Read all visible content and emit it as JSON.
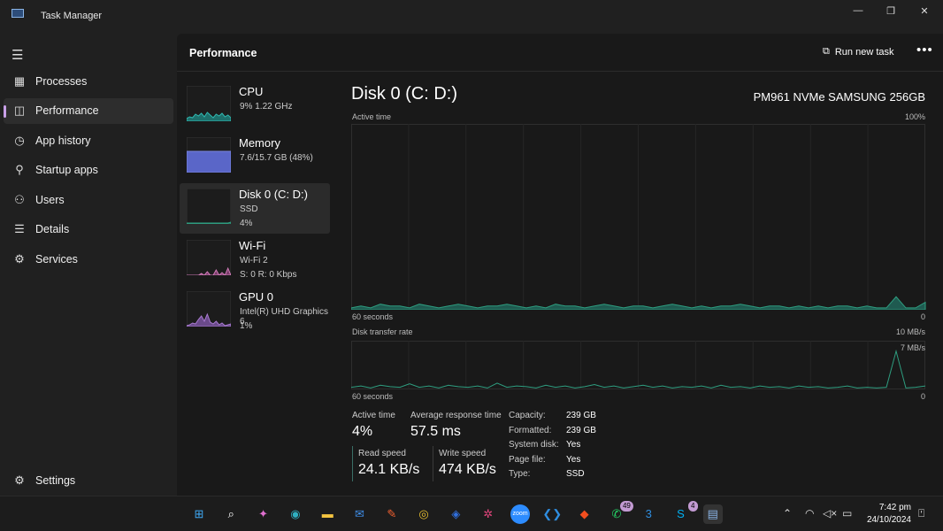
{
  "window": {
    "title": "Task Manager",
    "min": "—",
    "max": "❐",
    "close": "✕"
  },
  "sidebar": {
    "items": [
      {
        "label": "Processes",
        "icon": "▦"
      },
      {
        "label": "Performance",
        "icon": "◫"
      },
      {
        "label": "App history",
        "icon": "◷"
      },
      {
        "label": "Startup apps",
        "icon": "⚲"
      },
      {
        "label": "Users",
        "icon": "⚇"
      },
      {
        "label": "Details",
        "icon": "☰"
      },
      {
        "label": "Services",
        "icon": "⚙"
      }
    ],
    "settings": "Settings"
  },
  "header": {
    "title": "Performance",
    "run_new_task": "Run new task",
    "more": "•••"
  },
  "devices": [
    {
      "name": "CPU",
      "line1": "9%  1.22 GHz",
      "line2": "",
      "color": "#2fb8b0",
      "fill": "#1e6f6b"
    },
    {
      "name": "Memory",
      "line1": "7.6/15.7 GB (48%)",
      "line2": "",
      "color": "#7b86e0",
      "fill": "#5a66c8"
    },
    {
      "name": "Disk 0 (C: D:)",
      "line1": "SSD",
      "line2": "4%",
      "color": "#2e9e80",
      "fill": "#1f5f50"
    },
    {
      "name": "Wi-Fi",
      "line1": "Wi-Fi 2",
      "line2": "S: 0  R: 0 Kbps",
      "color": "#d07ab8",
      "fill": "#7a3d6a"
    },
    {
      "name": "GPU 0",
      "line1": "Intel(R) UHD Graphics 6",
      "line2": "1%",
      "color": "#a87ad0",
      "fill": "#6a4a8a"
    }
  ],
  "detail": {
    "title": "Disk 0 (C: D:)",
    "model": "PM961 NVMe SAMSUNG 256GB",
    "graph1": {
      "label": "Active time",
      "max": "100%",
      "time": "60 seconds",
      "min": "0",
      "values_percent": [
        1,
        2,
        1,
        3,
        2,
        2,
        1,
        3,
        2,
        1,
        2,
        3,
        2,
        1,
        2,
        2,
        3,
        2,
        1,
        2,
        1,
        3,
        2,
        2,
        1,
        2,
        3,
        2,
        1,
        2,
        2,
        1,
        2,
        3,
        2,
        1,
        2,
        1,
        2,
        2,
        3,
        2,
        1,
        2,
        2,
        1,
        2,
        1,
        2,
        1,
        2,
        2,
        1,
        2,
        1,
        1,
        7,
        1,
        1,
        4
      ]
    },
    "graph2": {
      "label": "Disk transfer rate",
      "max": "10 MB/s",
      "scale": "7 MB/s",
      "time": "60 seconds",
      "min": "0",
      "values_mbps": [
        0.3,
        0.5,
        0.2,
        0.6,
        0.4,
        0.3,
        0.8,
        0.3,
        0.5,
        0.2,
        0.6,
        0.4,
        0.3,
        0.5,
        0.2,
        0.9,
        0.3,
        0.5,
        0.4,
        0.2,
        0.6,
        0.3,
        0.5,
        0.2,
        0.4,
        0.7,
        0.3,
        0.5,
        0.2,
        0.4,
        0.6,
        0.3,
        0.5,
        0.2,
        0.4,
        0.3,
        0.5,
        0.2,
        0.6,
        0.3,
        0.4,
        0.2,
        0.5,
        0.3,
        0.4,
        0.2,
        0.5,
        0.3,
        0.4,
        0.2,
        0.3,
        0.5,
        0.2,
        0.3,
        0.2,
        0.3,
        5.5,
        0.2,
        0.3,
        0.5
      ]
    },
    "active_time": {
      "label": "Active time",
      "value": "4%"
    },
    "avg_response": {
      "label": "Average response time",
      "value": "57.5 ms"
    },
    "read": {
      "label": "Read speed",
      "value": "24.1 KB/s"
    },
    "write": {
      "label": "Write speed",
      "value": "474 KB/s"
    },
    "props": [
      {
        "k": "Capacity:",
        "v": "239 GB"
      },
      {
        "k": "Formatted:",
        "v": "239 GB"
      },
      {
        "k": "System disk:",
        "v": "Yes"
      },
      {
        "k": "Page file:",
        "v": "Yes"
      },
      {
        "k": "Type:",
        "v": "SSD"
      }
    ]
  },
  "taskbar": {
    "apps": [
      {
        "name": "start",
        "g": "⊞",
        "c": "#3fa9f5"
      },
      {
        "name": "search",
        "g": "⌕",
        "c": "#fff"
      },
      {
        "name": "copilot",
        "g": "✦",
        "c": "#e070d0"
      },
      {
        "name": "edge",
        "g": "◉",
        "c": "#2fb0c0"
      },
      {
        "name": "file-explorer",
        "g": "▬",
        "c": "#f3c340"
      },
      {
        "name": "mail",
        "g": "✉",
        "c": "#3f8ee8"
      },
      {
        "name": "app-orange",
        "g": "✎",
        "c": "#f06030"
      },
      {
        "name": "chrome",
        "g": "◎",
        "c": "#e8c030"
      },
      {
        "name": "app-blue",
        "g": "◈",
        "c": "#3070e0"
      },
      {
        "name": "slack",
        "g": "✲",
        "c": "#e0457b"
      },
      {
        "name": "zoom",
        "g": "zoom",
        "c": "#2d8cff"
      },
      {
        "name": "vscode",
        "g": "❮❯",
        "c": "#2f8ee0"
      },
      {
        "name": "figma",
        "g": "◆",
        "c": "#f24e1e"
      },
      {
        "name": "whatsapp",
        "g": "✆",
        "c": "#25d366",
        "badge": "49"
      },
      {
        "name": "app-3",
        "g": "3",
        "c": "#2f8ee0"
      },
      {
        "name": "skype",
        "g": "S",
        "c": "#00aff0",
        "badge": "4"
      },
      {
        "name": "task-manager",
        "g": "▤",
        "c": "#8ab4e6"
      }
    ],
    "time": "7:42 pm",
    "date": "24/10/2024"
  }
}
